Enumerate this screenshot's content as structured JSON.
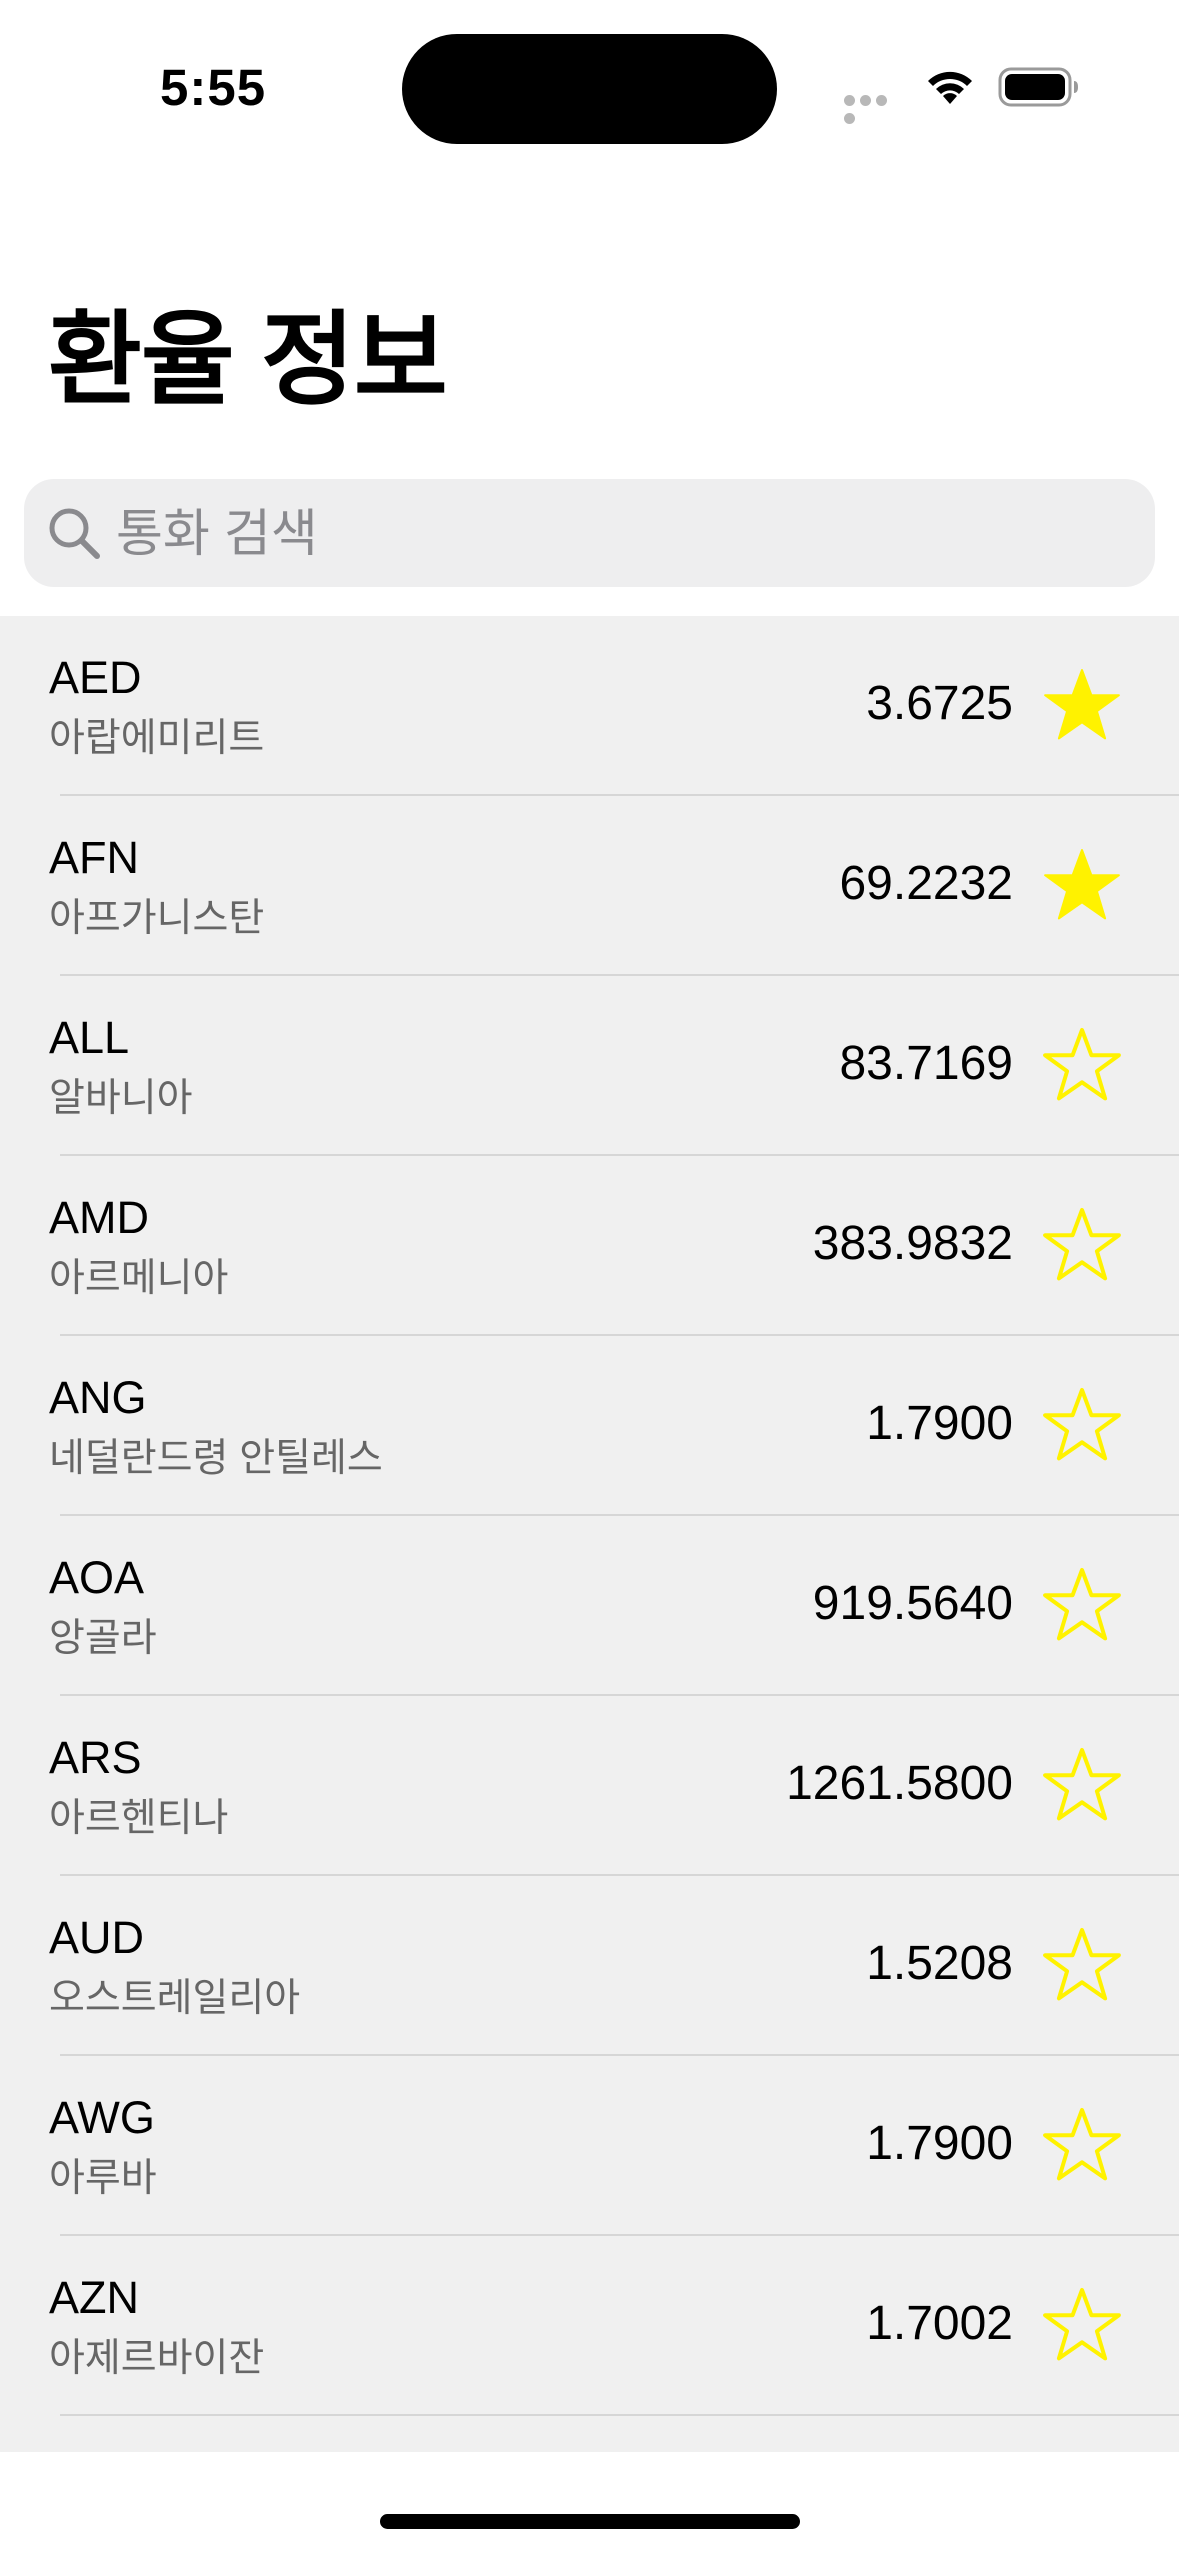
{
  "status_bar": {
    "time": "5:55"
  },
  "header": {
    "title": "환율 정보"
  },
  "search": {
    "placeholder": "통화 검색",
    "value": ""
  },
  "colors": {
    "star": "#FFF200",
    "background": "#F0F0F0"
  },
  "icons": {
    "search": "search-icon",
    "favorite_on": "star-filled-icon",
    "favorite_off": "star-outline-icon"
  },
  "currencies": [
    {
      "code": "AED",
      "name": "아랍에미리트",
      "rate": "3.6725",
      "favorite": true
    },
    {
      "code": "AFN",
      "name": "아프가니스탄",
      "rate": "69.2232",
      "favorite": true
    },
    {
      "code": "ALL",
      "name": "알바니아",
      "rate": "83.7169",
      "favorite": false
    },
    {
      "code": "AMD",
      "name": "아르메니아",
      "rate": "383.9832",
      "favorite": false
    },
    {
      "code": "ANG",
      "name": "네덜란드령 안틸레스",
      "rate": "1.7900",
      "favorite": false
    },
    {
      "code": "AOA",
      "name": "앙골라",
      "rate": "919.5640",
      "favorite": false
    },
    {
      "code": "ARS",
      "name": "아르헨티나",
      "rate": "1261.5800",
      "favorite": false
    },
    {
      "code": "AUD",
      "name": "오스트레일리아",
      "rate": "1.5208",
      "favorite": false
    },
    {
      "code": "AWG",
      "name": "아루바",
      "rate": "1.7900",
      "favorite": false
    },
    {
      "code": "AZN",
      "name": "아제르바이잔",
      "rate": "1.7002",
      "favorite": false
    }
  ]
}
